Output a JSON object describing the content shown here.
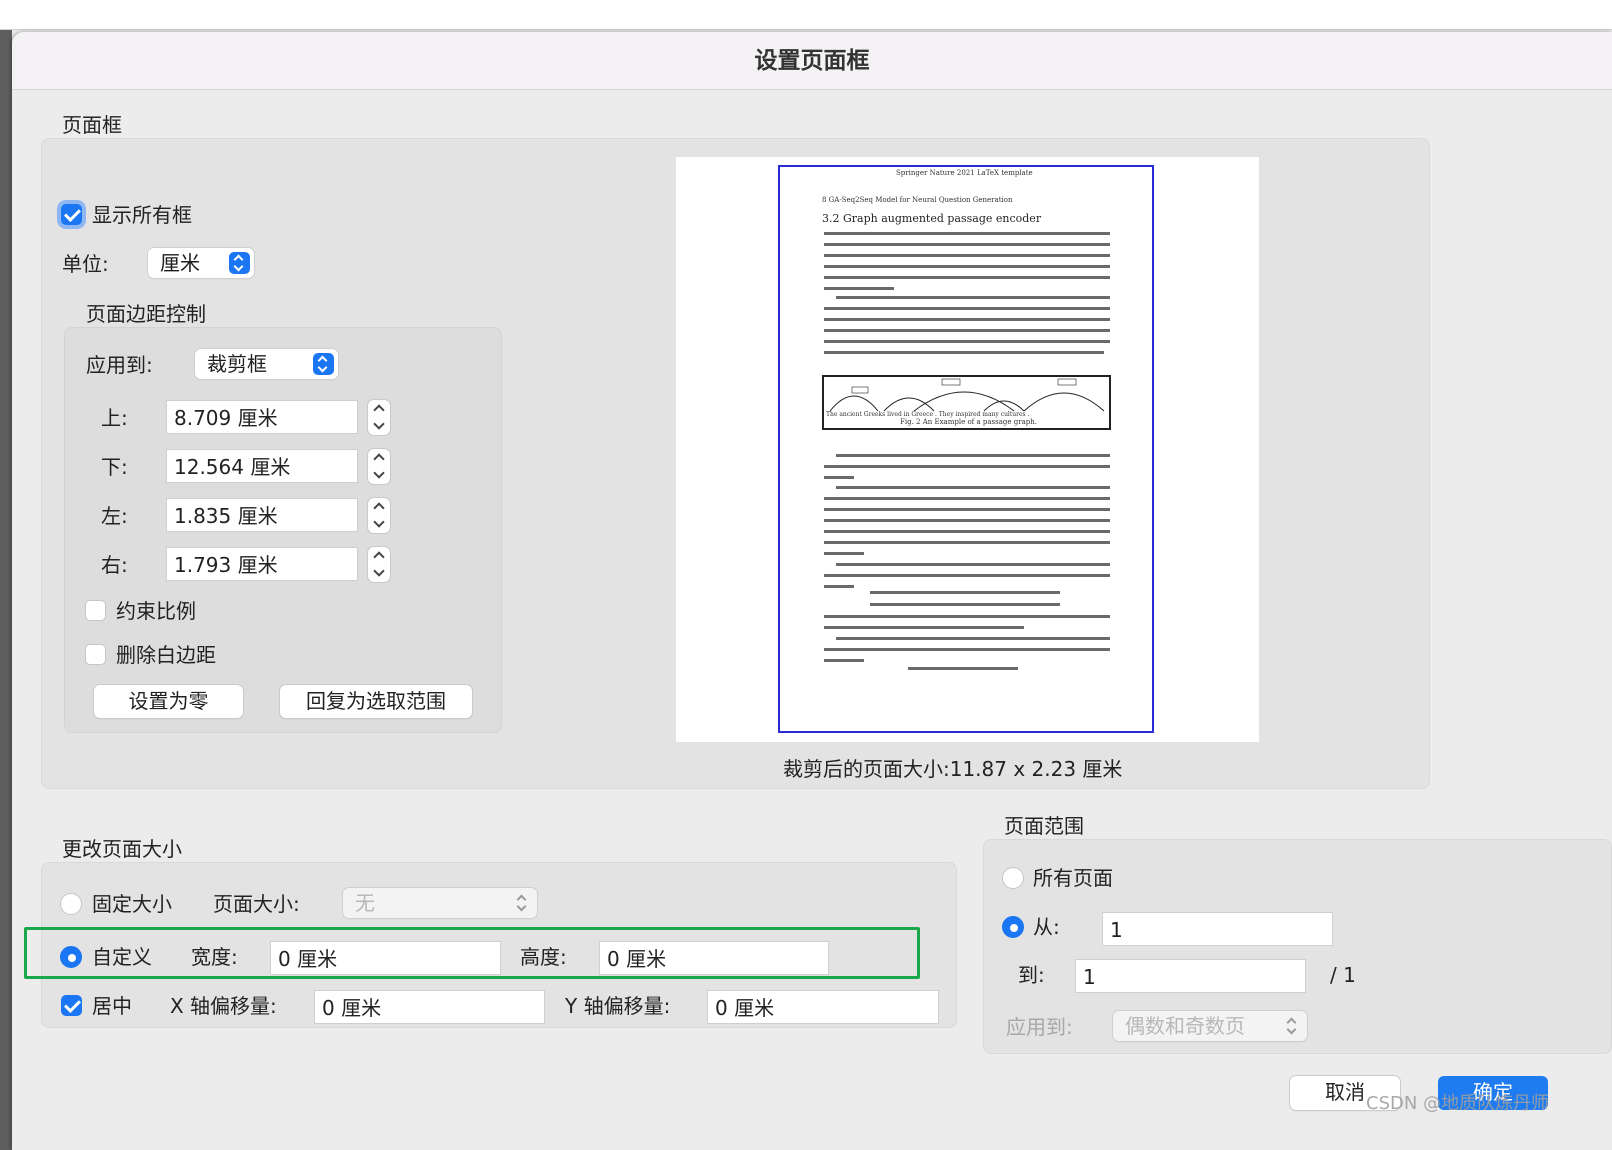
{
  "dialog": {
    "title": "设置页面框"
  },
  "page_frame": {
    "section_title": "页面框",
    "show_all_label": "显示所有框",
    "unit_label": "单位:",
    "unit_value": "厘米",
    "margins": {
      "title": "页面边距控制",
      "apply_label": "应用到:",
      "apply_value": "裁剪框",
      "top_label": "上:",
      "top_value": "8.709 厘米",
      "bottom_label": "下:",
      "bottom_value": "12.564 厘米",
      "left_label": "左:",
      "left_value": "1.835 厘米",
      "right_label": "右:",
      "right_value": "1.793 厘米",
      "constrain_label": "约束比例",
      "remove_white_label": "删除白边距",
      "set_zero_label": "设置为零",
      "revert_label": "回复为选取范围"
    },
    "cropped_size_text": "裁剪后的页面大小:11.87 x 2.23 厘米"
  },
  "preview": {
    "header": "Springer Nature 2021 LaTeX template",
    "running": "8      GA-Seq2Seq Model for Neural Question Generation",
    "section": "3.2  Graph augmented passage encoder",
    "caption": "Fig. 2 An Example of a passage graph.",
    "fig_words": "The  ancient  Greeks  lived  in  Greece  .  They  inspired  many  cultures  ."
  },
  "resize": {
    "section_title": "更改页面大小",
    "fixed_label": "固定大小",
    "page_size_label": "页面大小:",
    "page_size_value": "无",
    "custom_label": "自定义",
    "width_label": "宽度:",
    "width_value": "0 厘米",
    "height_label": "高度:",
    "height_value": "0 厘米",
    "center_label": "居中",
    "x_offset_label": "X 轴偏移量:",
    "x_offset_value": "0 厘米",
    "y_offset_label": "Y 轴偏移量:",
    "y_offset_value": "0 厘米"
  },
  "range": {
    "section_title": "页面范围",
    "all_label": "所有页面",
    "from_label": "从:",
    "from_value": "1",
    "to_label": "到:",
    "to_value": "1",
    "total": "/ 1",
    "apply_label": "应用到:",
    "apply_value": "偶数和奇数页"
  },
  "footer": {
    "cancel_label": "取消",
    "ok_label": "确定"
  },
  "watermark": "CSDN @地质队炼丹师",
  "colors": {
    "accent": "#1a76f2",
    "highlight": "#19a84b",
    "crop_frame": "#2a2ad8"
  }
}
